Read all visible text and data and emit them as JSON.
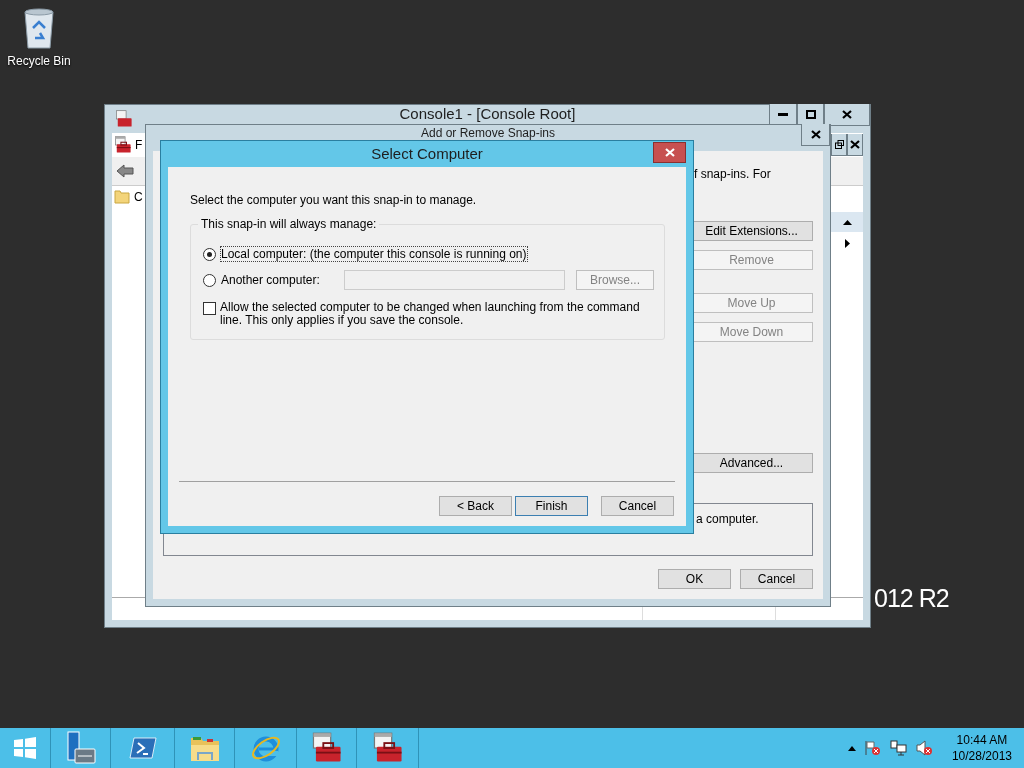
{
  "desktop": {
    "icons": [
      {
        "label": "Recycle Bin"
      }
    ],
    "branding": "012 R2"
  },
  "console_window": {
    "title": "Console1 - [Console Root]",
    "menu": [
      "F"
    ],
    "tree": [
      "C"
    ]
  },
  "snapins_window": {
    "title": "Add or Remove Snap-ins",
    "description_start": "f snap-ins. For",
    "side_buttons": [
      {
        "label": "Edit Extensions...",
        "disabled": false
      },
      {
        "label": "Remove",
        "disabled": true
      },
      {
        "label": "Move Up",
        "disabled": true
      },
      {
        "label": "Move Down",
        "disabled": true
      }
    ],
    "advanced_button": "Advanced...",
    "info_text": "a computer.",
    "buttons": [
      "OK",
      "Cancel"
    ]
  },
  "dialog": {
    "title": "Select Computer",
    "prompt": "Select the computer you want this snap-in to manage.",
    "group_label": "This snap-in will always manage:",
    "options": [
      {
        "label": "Local computer:  (the computer this console is running on)",
        "selected": true
      },
      {
        "label": "Another computer:",
        "selected": false
      }
    ],
    "computer_field": {
      "disabled": true
    },
    "browse_button": {
      "label": "Browse...",
      "disabled": true
    },
    "allow_checkbox": {
      "label": "Allow the selected computer to be changed when launching from the command line.  This only applies if you save the console.",
      "checked": false
    },
    "buttons": [
      {
        "label": "< Back",
        "default": false
      },
      {
        "label": "Finish",
        "default": true
      },
      {
        "label": "Cancel",
        "default": false
      }
    ]
  },
  "taskbar": {
    "items": [
      {
        "kind": "start"
      },
      {
        "kind": "server"
      },
      {
        "kind": "shell"
      },
      {
        "kind": "folder"
      },
      {
        "kind": "browser"
      },
      {
        "kind": "toolbox"
      },
      {
        "kind": "toolbox"
      }
    ]
  },
  "clock": {
    "time": "10:44 AM",
    "date": "10/28/2013"
  }
}
